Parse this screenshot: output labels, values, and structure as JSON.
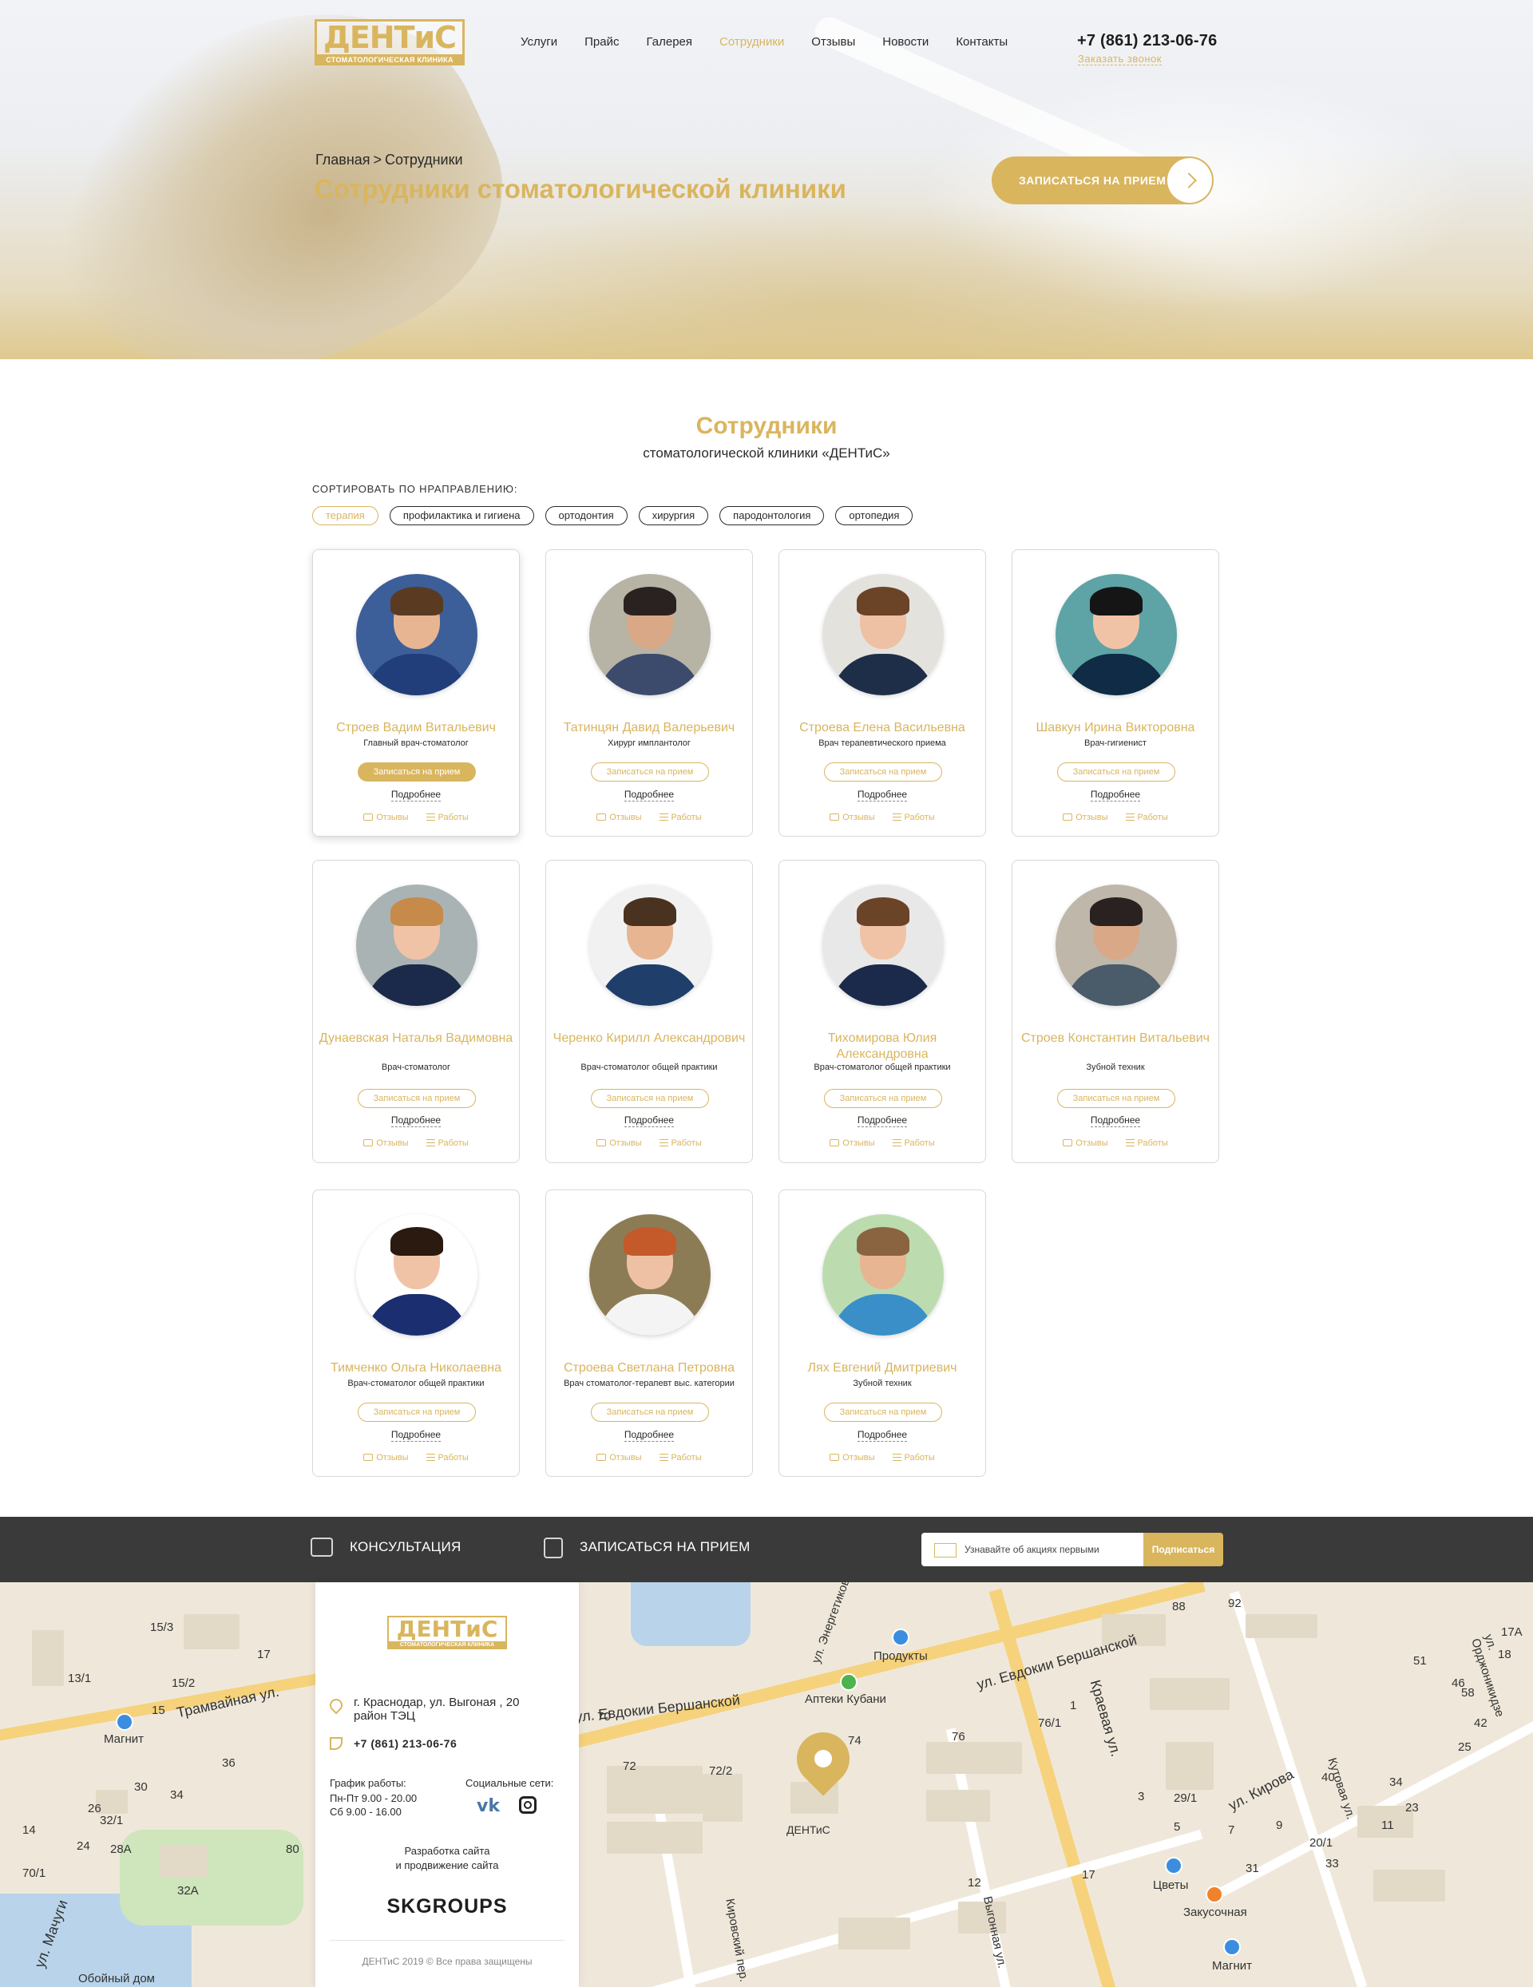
{
  "header": {
    "logo_word": "ДЕНТиС",
    "logo_sub": "стоматологическая клиника",
    "nav": [
      "Услуги",
      "Прайс",
      "Галерея",
      "Сотрудники",
      "Отзывы",
      "Новости",
      "Контакты"
    ],
    "nav_active_index": 3,
    "phone": "+7 (861) 213-06-76",
    "callback": "Заказать звонок"
  },
  "hero": {
    "breadcrumb": [
      "Главная",
      ">",
      "Сотрудники"
    ],
    "title": "Сотрудники стоматологической клиники",
    "cta": "ЗАПИСАТЬСЯ НА ПРИЕМ",
    "cta_icon": "chevron-right-icon"
  },
  "section": {
    "title": "Сотрудники",
    "subtitle": "стоматологической клиники «ДЕНТиС»",
    "sort_label": "Сортировать по нраправлению:",
    "filters": [
      "терапия",
      "профилактика и гигиена",
      "ортодонтия",
      "хирургия",
      "пародонтология",
      "ортопедия"
    ],
    "active_filter_index": 0
  },
  "card_labels": {
    "book": "Записаться на прием",
    "more": "Подробнее",
    "reviews": "Отзывы",
    "works": "Работы"
  },
  "staff": [
    {
      "name": "Строев Вадим Витальевич",
      "position": "Главный врач-стоматолог"
    },
    {
      "name": "Татинцян Давид Валерьевич",
      "position": "Хирург имплантолог"
    },
    {
      "name": "Строева Елена Васильевна",
      "position": "Врач терапевтического приема"
    },
    {
      "name": "Шавкун Ирина Викторовна",
      "position": "Врач-гигиенист"
    },
    {
      "name": "Дунаевская Наталья Вадимовна",
      "position": "Врач-стоматолог"
    },
    {
      "name": "Черенко Кирилл Александрович",
      "position": "Врач-стоматолог общей практики"
    },
    {
      "name": "Тихомирова Юлия Александровна",
      "position": "Врач-стоматолог общей практики"
    },
    {
      "name": "Строев Константин Витальевич",
      "position": "Зубной техник"
    },
    {
      "name": "Тимченко Ольга Николаевна",
      "position": "Врач-стоматолог общей практики"
    },
    {
      "name": "Строева Светлана Петровна",
      "position": "Врач стоматолог-терапевт выс. категории"
    },
    {
      "name": "Лях Евгений Дмитриевич",
      "position": "Зубной техник"
    }
  ],
  "bar": {
    "consult": "КОНСУЛЬТАЦИЯ",
    "book": "ЗАПИСАТЬСЯ НА ПРИЕМ",
    "subscribe_placeholder": "Узнавайте об акциях первыми",
    "subscribe_btn": "Подписаться"
  },
  "footer": {
    "address": "г. Краснодар, ул. Выгоная , 20 район ТЭЦ",
    "phone": "+7 (861) 213-06-76",
    "hours_label": "График работы:",
    "hours": [
      "Пн-Пт  9.00 - 20.00",
      "Сб  9.00 - 16.00"
    ],
    "social_label": "Социальные сети:",
    "vk": "vk",
    "dev": [
      "Разработка сайта",
      "и продвижение сайта"
    ],
    "dev_brand": "SKGROUPS",
    "copyright": "ДЕНТиС 2019 © Все права защищены"
  },
  "map": {
    "clinic_label": "ДЕНТиС",
    "streets": [
      "Трамвайная ул.",
      "ул. Евдокии Бершанской",
      "Краевая ул.",
      "ул. Кирова",
      "Кировский пер.",
      "ул. Мачуги",
      "Кутовая ул.",
      "ул. Орджоникидзе",
      "Выгонная ул.",
      "ул. Энергетиков"
    ],
    "pois": [
      "Продукты",
      "Аптеки Кубани",
      "Магнит",
      "Цветы",
      "Закусочная",
      "Магнит",
      "Обойный дом"
    ],
    "numbers": [
      "15/3",
      "17",
      "13/1",
      "15/2",
      "15",
      "36",
      "30",
      "34",
      "26",
      "24",
      "28А",
      "32/1",
      "80",
      "14",
      "32А",
      "70/1",
      "70",
      "72",
      "72/2",
      "74",
      "76",
      "76/1",
      "1",
      "3",
      "5",
      "7",
      "9",
      "11",
      "12",
      "17",
      "20/1",
      "23",
      "25",
      "29/1",
      "31",
      "33",
      "34",
      "40",
      "42",
      "46",
      "51",
      "58",
      "88",
      "92",
      "17А",
      "18"
    ]
  }
}
